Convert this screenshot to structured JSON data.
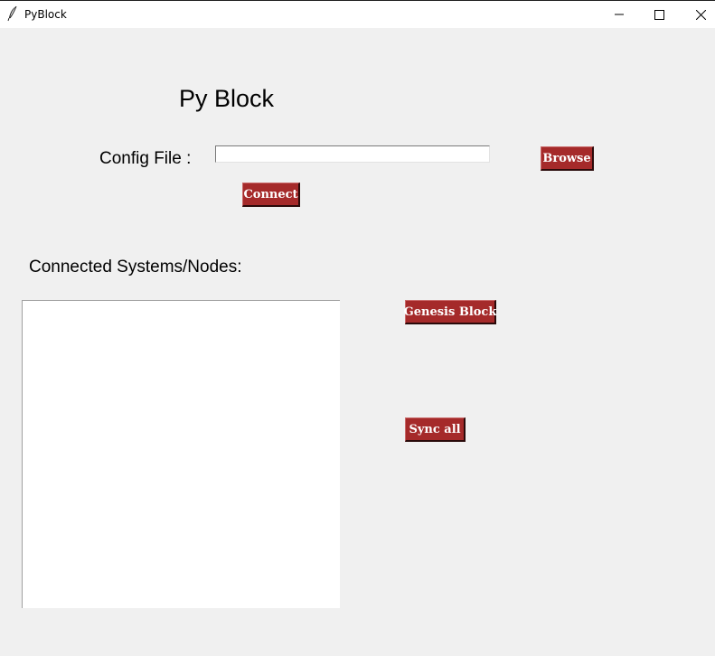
{
  "window": {
    "title": "PyBlock",
    "icon": "feather-icon"
  },
  "main": {
    "heading": "Py Block",
    "config_label": "Config File :",
    "config_value": "",
    "browse_label": "Browse",
    "connect_label": "Connect",
    "nodes_label": "Connected Systems/Nodes:",
    "nodes": [],
    "genesis_label": "Genesis Block",
    "sync_label": "Sync all"
  },
  "colors": {
    "button_bg": "#a52a2a",
    "button_text": "#ffffff",
    "window_bg": "#f0f0f0"
  }
}
